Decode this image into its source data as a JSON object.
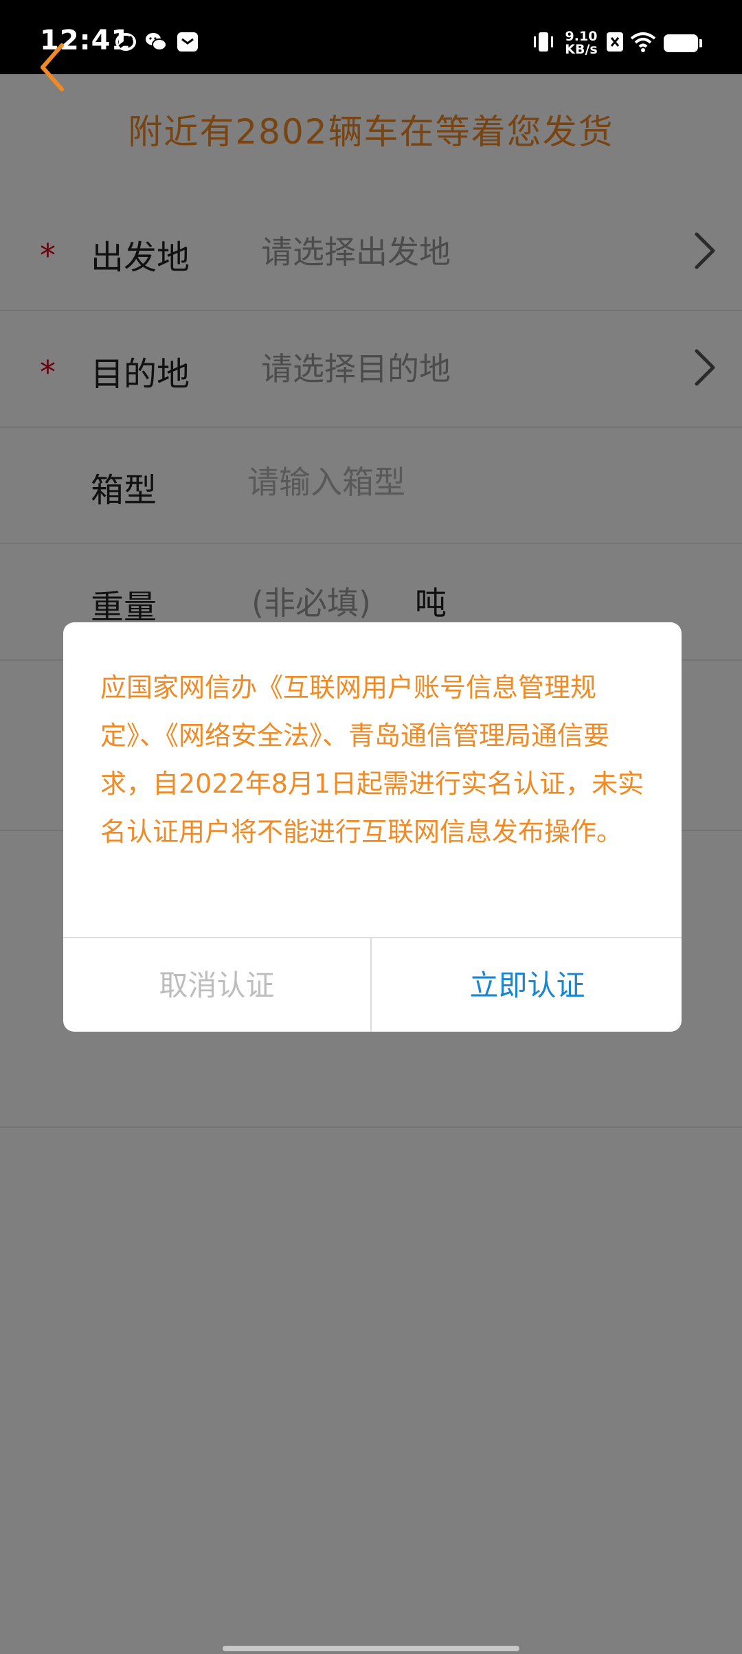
{
  "status_bar": {
    "time": "12:41",
    "net_speed_value": "9.10",
    "net_speed_unit": "KB/s",
    "icons": [
      "link-icon",
      "wechat-icon",
      "mail-icon",
      "vibrate-icon",
      "sim-off-icon",
      "wifi-icon",
      "battery-icon"
    ]
  },
  "header": {
    "back_icon": "chevron-left-icon",
    "headline": "附近有2802辆车在等着您发货"
  },
  "form": {
    "origin": {
      "required_mark": "*",
      "label": "出发地",
      "value": "请选择出发地"
    },
    "destination": {
      "required_mark": "*",
      "label": "目的地",
      "value": "请选择目的地"
    },
    "box_type": {
      "label": "箱型",
      "placeholder": "请输入箱型",
      "value": ""
    },
    "weight": {
      "label": "重量",
      "hint": "(非必填)",
      "unit": "吨"
    }
  },
  "dialog": {
    "message": "应国家网信办《互联网用户账号信息管理规定》、《网络安全法》、青岛通信管理局通信要求，自2022年8月1日起需进行实名认证，未实名认证用户将不能进行互联网信息发布操作。",
    "cancel_label": "取消认证",
    "confirm_label": "立即认证"
  },
  "colors": {
    "accent_orange": "#f08a24",
    "link_blue": "#1a86d0",
    "required_red": "#d0021b",
    "overlay": "rgba(0,0,0,0.5)"
  }
}
